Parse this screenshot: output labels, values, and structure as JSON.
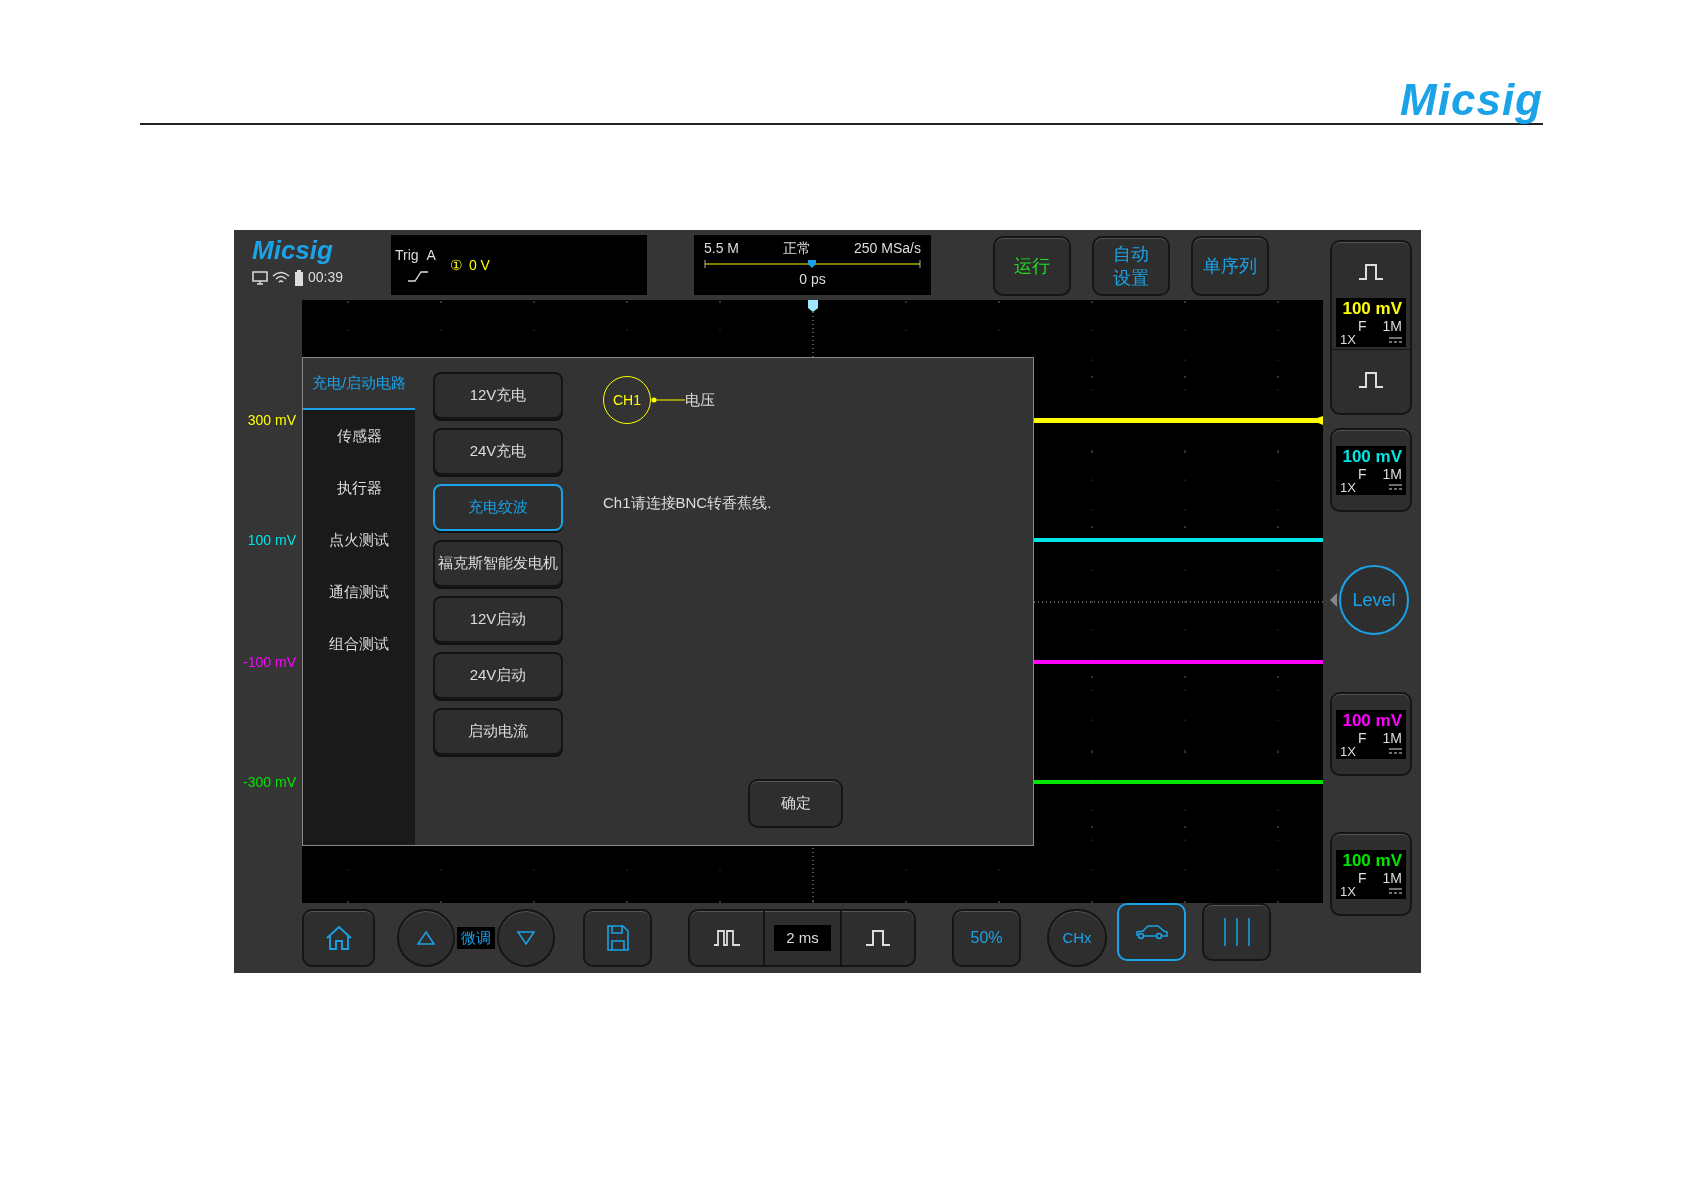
{
  "page_logo": "Micsig",
  "status": {
    "logo": "Micsig",
    "time": "00:39"
  },
  "trigger": {
    "label": "Trig",
    "source": "A",
    "channel": "①",
    "level": "0 V"
  },
  "acquisition": {
    "depth": "5.5 M",
    "mode": "正常",
    "rate": "250 MSa/s",
    "offset": "0 ps"
  },
  "top_buttons": [
    {
      "lines": [
        "运行"
      ],
      "color": "#22dd22"
    },
    {
      "lines": [
        "自动",
        "设置"
      ],
      "color": "#1aa3e8"
    },
    {
      "lines": [
        "单序列"
      ],
      "color": "#1aa3e8"
    }
  ],
  "scale_labels": [
    {
      "text": "300 mV",
      "color": "#ffff00"
    },
    {
      "text": "100 mV",
      "color": "#00e5e5"
    },
    {
      "text": "-100 mV",
      "color": "#ff00ff"
    },
    {
      "text": "-300 mV",
      "color": "#00e600"
    }
  ],
  "channels": [
    {
      "scale": "100 mV",
      "coupling": "F",
      "impedance": "1M",
      "probe": "1X",
      "color": "#ffff00"
    },
    {
      "scale": "100 mV",
      "coupling": "F",
      "impedance": "1M",
      "probe": "1X",
      "color": "#00e5e5"
    },
    {
      "scale": "100 mV",
      "coupling": "F",
      "impedance": "1M",
      "probe": "1X",
      "color": "#ff00ff"
    },
    {
      "scale": "100 mV",
      "coupling": "F",
      "impedance": "1M",
      "probe": "1X",
      "color": "#00e600"
    }
  ],
  "level_button": "Level",
  "dialog": {
    "categories": [
      {
        "label": "充电/启动电路",
        "selected": true
      },
      {
        "label": "传感器",
        "selected": false
      },
      {
        "label": "执行器",
        "selected": false
      },
      {
        "label": "点火测试",
        "selected": false
      },
      {
        "label": "通信测试",
        "selected": false
      },
      {
        "label": "组合测试",
        "selected": false
      }
    ],
    "tests": [
      {
        "label": "12V充电",
        "selected": false
      },
      {
        "label": "24V充电",
        "selected": false
      },
      {
        "label": "充电纹波",
        "selected": true
      },
      {
        "label": "福克斯智能发电机",
        "selected": false
      },
      {
        "label": "12V启动",
        "selected": false
      },
      {
        "label": "24V启动",
        "selected": false
      },
      {
        "label": "启动电流",
        "selected": false
      }
    ],
    "probe_channel": "CH1",
    "probe_signal": "电压",
    "instruction": "Ch1请连接BNC转香蕉线.",
    "confirm": "确定"
  },
  "bottom_bar": {
    "fine_tune": "微调",
    "timebase": "2 ms",
    "trigger_percent": "50%",
    "channel_button": "CHx",
    "car_mode": {
      "selected": true
    }
  }
}
